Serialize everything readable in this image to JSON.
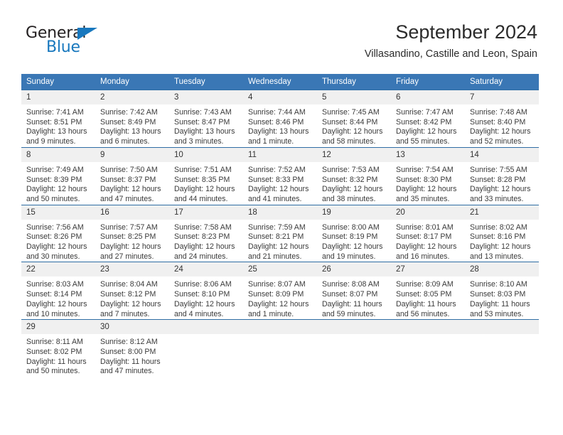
{
  "brand": {
    "line1": "General",
    "line2": "Blue",
    "triangle_color": "#1878be",
    "text_color": "#231f20"
  },
  "header": {
    "title": "September 2024",
    "subtitle": "Villasandino, Castille and Leon, Spain"
  },
  "theme": {
    "header_blue": "#3a77b5",
    "row_rule_blue": "#2e6da4",
    "daynum_bg": "#f0f0f0"
  },
  "calendar": {
    "weekday_headers": [
      "Sunday",
      "Monday",
      "Tuesday",
      "Wednesday",
      "Thursday",
      "Friday",
      "Saturday"
    ],
    "weeks": [
      [
        {
          "day": "1",
          "sunrise": "Sunrise: 7:41 AM",
          "sunset": "Sunset: 8:51 PM",
          "daylight": "Daylight: 13 hours and 9 minutes."
        },
        {
          "day": "2",
          "sunrise": "Sunrise: 7:42 AM",
          "sunset": "Sunset: 8:49 PM",
          "daylight": "Daylight: 13 hours and 6 minutes."
        },
        {
          "day": "3",
          "sunrise": "Sunrise: 7:43 AM",
          "sunset": "Sunset: 8:47 PM",
          "daylight": "Daylight: 13 hours and 3 minutes."
        },
        {
          "day": "4",
          "sunrise": "Sunrise: 7:44 AM",
          "sunset": "Sunset: 8:46 PM",
          "daylight": "Daylight: 13 hours and 1 minute."
        },
        {
          "day": "5",
          "sunrise": "Sunrise: 7:45 AM",
          "sunset": "Sunset: 8:44 PM",
          "daylight": "Daylight: 12 hours and 58 minutes."
        },
        {
          "day": "6",
          "sunrise": "Sunrise: 7:47 AM",
          "sunset": "Sunset: 8:42 PM",
          "daylight": "Daylight: 12 hours and 55 minutes."
        },
        {
          "day": "7",
          "sunrise": "Sunrise: 7:48 AM",
          "sunset": "Sunset: 8:40 PM",
          "daylight": "Daylight: 12 hours and 52 minutes."
        }
      ],
      [
        {
          "day": "8",
          "sunrise": "Sunrise: 7:49 AM",
          "sunset": "Sunset: 8:39 PM",
          "daylight": "Daylight: 12 hours and 50 minutes."
        },
        {
          "day": "9",
          "sunrise": "Sunrise: 7:50 AM",
          "sunset": "Sunset: 8:37 PM",
          "daylight": "Daylight: 12 hours and 47 minutes."
        },
        {
          "day": "10",
          "sunrise": "Sunrise: 7:51 AM",
          "sunset": "Sunset: 8:35 PM",
          "daylight": "Daylight: 12 hours and 44 minutes."
        },
        {
          "day": "11",
          "sunrise": "Sunrise: 7:52 AM",
          "sunset": "Sunset: 8:33 PM",
          "daylight": "Daylight: 12 hours and 41 minutes."
        },
        {
          "day": "12",
          "sunrise": "Sunrise: 7:53 AM",
          "sunset": "Sunset: 8:32 PM",
          "daylight": "Daylight: 12 hours and 38 minutes."
        },
        {
          "day": "13",
          "sunrise": "Sunrise: 7:54 AM",
          "sunset": "Sunset: 8:30 PM",
          "daylight": "Daylight: 12 hours and 35 minutes."
        },
        {
          "day": "14",
          "sunrise": "Sunrise: 7:55 AM",
          "sunset": "Sunset: 8:28 PM",
          "daylight": "Daylight: 12 hours and 33 minutes."
        }
      ],
      [
        {
          "day": "15",
          "sunrise": "Sunrise: 7:56 AM",
          "sunset": "Sunset: 8:26 PM",
          "daylight": "Daylight: 12 hours and 30 minutes."
        },
        {
          "day": "16",
          "sunrise": "Sunrise: 7:57 AM",
          "sunset": "Sunset: 8:25 PM",
          "daylight": "Daylight: 12 hours and 27 minutes."
        },
        {
          "day": "17",
          "sunrise": "Sunrise: 7:58 AM",
          "sunset": "Sunset: 8:23 PM",
          "daylight": "Daylight: 12 hours and 24 minutes."
        },
        {
          "day": "18",
          "sunrise": "Sunrise: 7:59 AM",
          "sunset": "Sunset: 8:21 PM",
          "daylight": "Daylight: 12 hours and 21 minutes."
        },
        {
          "day": "19",
          "sunrise": "Sunrise: 8:00 AM",
          "sunset": "Sunset: 8:19 PM",
          "daylight": "Daylight: 12 hours and 19 minutes."
        },
        {
          "day": "20",
          "sunrise": "Sunrise: 8:01 AM",
          "sunset": "Sunset: 8:17 PM",
          "daylight": "Daylight: 12 hours and 16 minutes."
        },
        {
          "day": "21",
          "sunrise": "Sunrise: 8:02 AM",
          "sunset": "Sunset: 8:16 PM",
          "daylight": "Daylight: 12 hours and 13 minutes."
        }
      ],
      [
        {
          "day": "22",
          "sunrise": "Sunrise: 8:03 AM",
          "sunset": "Sunset: 8:14 PM",
          "daylight": "Daylight: 12 hours and 10 minutes."
        },
        {
          "day": "23",
          "sunrise": "Sunrise: 8:04 AM",
          "sunset": "Sunset: 8:12 PM",
          "daylight": "Daylight: 12 hours and 7 minutes."
        },
        {
          "day": "24",
          "sunrise": "Sunrise: 8:06 AM",
          "sunset": "Sunset: 8:10 PM",
          "daylight": "Daylight: 12 hours and 4 minutes."
        },
        {
          "day": "25",
          "sunrise": "Sunrise: 8:07 AM",
          "sunset": "Sunset: 8:09 PM",
          "daylight": "Daylight: 12 hours and 1 minute."
        },
        {
          "day": "26",
          "sunrise": "Sunrise: 8:08 AM",
          "sunset": "Sunset: 8:07 PM",
          "daylight": "Daylight: 11 hours and 59 minutes."
        },
        {
          "day": "27",
          "sunrise": "Sunrise: 8:09 AM",
          "sunset": "Sunset: 8:05 PM",
          "daylight": "Daylight: 11 hours and 56 minutes."
        },
        {
          "day": "28",
          "sunrise": "Sunrise: 8:10 AM",
          "sunset": "Sunset: 8:03 PM",
          "daylight": "Daylight: 11 hours and 53 minutes."
        }
      ],
      [
        {
          "day": "29",
          "sunrise": "Sunrise: 8:11 AM",
          "sunset": "Sunset: 8:02 PM",
          "daylight": "Daylight: 11 hours and 50 minutes."
        },
        {
          "day": "30",
          "sunrise": "Sunrise: 8:12 AM",
          "sunset": "Sunset: 8:00 PM",
          "daylight": "Daylight: 11 hours and 47 minutes."
        },
        {
          "day": "",
          "sunrise": "",
          "sunset": "",
          "daylight": ""
        },
        {
          "day": "",
          "sunrise": "",
          "sunset": "",
          "daylight": ""
        },
        {
          "day": "",
          "sunrise": "",
          "sunset": "",
          "daylight": ""
        },
        {
          "day": "",
          "sunrise": "",
          "sunset": "",
          "daylight": ""
        },
        {
          "day": "",
          "sunrise": "",
          "sunset": "",
          "daylight": ""
        }
      ]
    ]
  }
}
